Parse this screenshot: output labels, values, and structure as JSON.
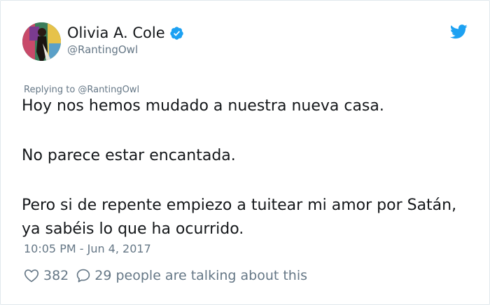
{
  "tweet": {
    "author": {
      "display_name": "Olivia A. Cole",
      "handle": "@RantingOwl",
      "verified": true
    },
    "reply_to": "Replying to @RantingOwl",
    "paragraphs": [
      "Hoy nos hemos mudado a nuestra nueva casa.",
      "No parece estar encantada.",
      "Pero si de repente empiezo a tuitear mi amor por Satán, ya sabéis lo que ha ocurrido."
    ],
    "timestamp": "10:05 PM - Jun 4, 2017",
    "likes": "382",
    "talking": "29 people are talking about this"
  },
  "colors": {
    "twitter_blue": "#1da1f2",
    "text": "#14171a",
    "secondary_text": "#657786",
    "border": "#e1e8ed"
  },
  "icons": {
    "platform_logo": "twitter-bird-icon",
    "verified": "verified-badge-icon",
    "like": "heart-outline-icon",
    "reply": "speech-bubble-icon"
  }
}
